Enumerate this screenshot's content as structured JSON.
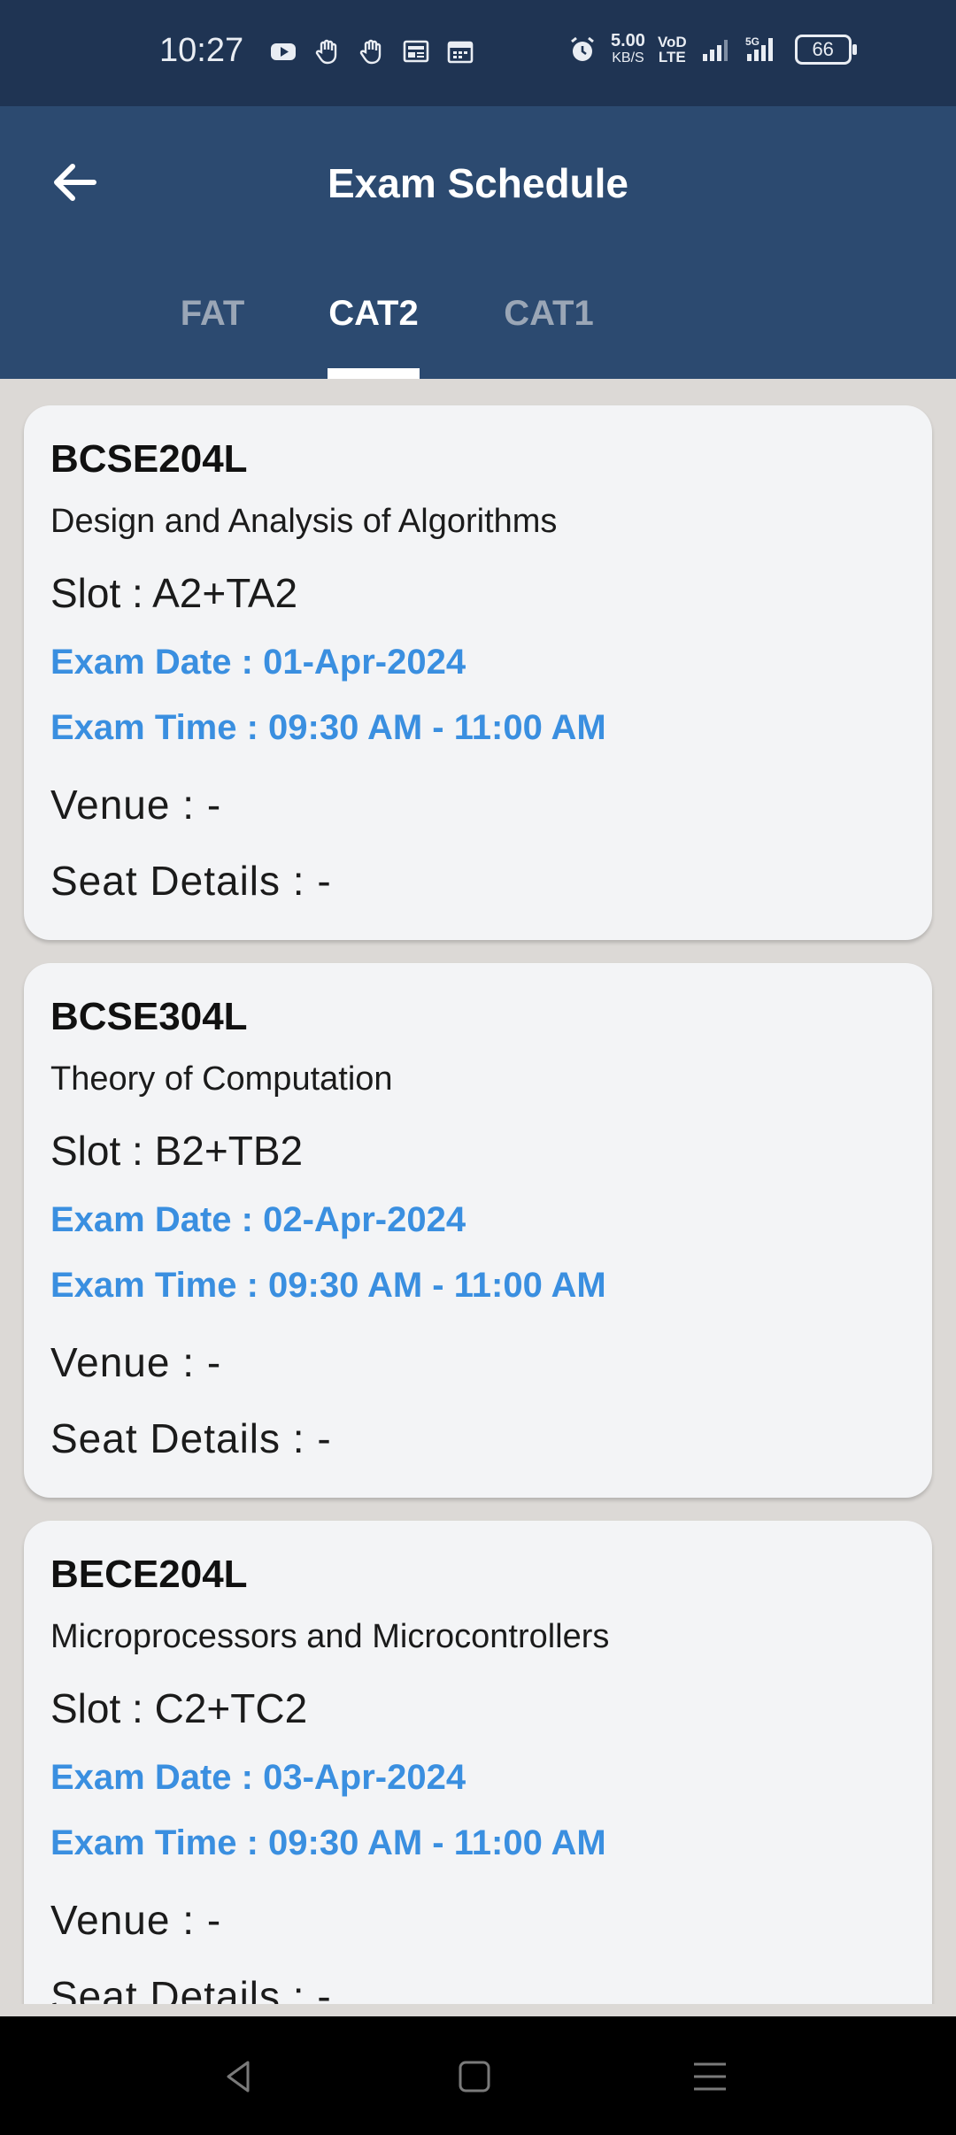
{
  "status_bar": {
    "time": "10:27",
    "speed_value": "5.00",
    "speed_unit": "KB/S",
    "volte_top": "VoD",
    "volte_bottom": "LTE",
    "network": "5G",
    "battery": "66",
    "icons_left": [
      "youtube-icon",
      "hand-icon",
      "hand-icon",
      "news-icon",
      "calendar-icon"
    ],
    "icons_right": [
      "alarm-icon",
      "signal-icon",
      "signal-5g-icon",
      "battery-icon"
    ]
  },
  "app_bar": {
    "title": "Exam Schedule",
    "back_icon": "arrow-left-icon",
    "tabs": [
      {
        "label": "FAT",
        "active": false
      },
      {
        "label": "CAT2",
        "active": true
      },
      {
        "label": "CAT1",
        "active": false
      }
    ]
  },
  "exams": [
    {
      "code": "BCSE204L",
      "name": "Design and Analysis of Algorithms",
      "slot": "Slot : A2+TA2",
      "date": "Exam Date : 01-Apr-2024",
      "time": "Exam Time : 09:30 AM - 11:00 AM",
      "venue": "Venue : -",
      "seat": "Seat Details : -"
    },
    {
      "code": "BCSE304L",
      "name": "Theory of Computation",
      "slot": "Slot : B2+TB2",
      "date": "Exam Date : 02-Apr-2024",
      "time": "Exam Time : 09:30 AM - 11:00 AM",
      "venue": "Venue : -",
      "seat": "Seat Details : -"
    },
    {
      "code": "BECE204L",
      "name": "Microprocessors and Microcontrollers",
      "slot": "Slot : C2+TC2",
      "date": "Exam Date : 03-Apr-2024",
      "time": "Exam Time : 09:30 AM - 11:00 AM",
      "venue": "Venue : -",
      "seat": "Seat Details : -"
    }
  ],
  "nav_bar": {
    "icons": [
      "back-triangle-icon",
      "home-square-icon",
      "menu-lines-icon"
    ]
  },
  "colors": {
    "status_bar": "#1f3453",
    "app_bar": "#2c4a70",
    "accent_text": "#3a8fe0",
    "card_bg": "#f3f4f6",
    "page_bg": "#dcd9d6"
  }
}
